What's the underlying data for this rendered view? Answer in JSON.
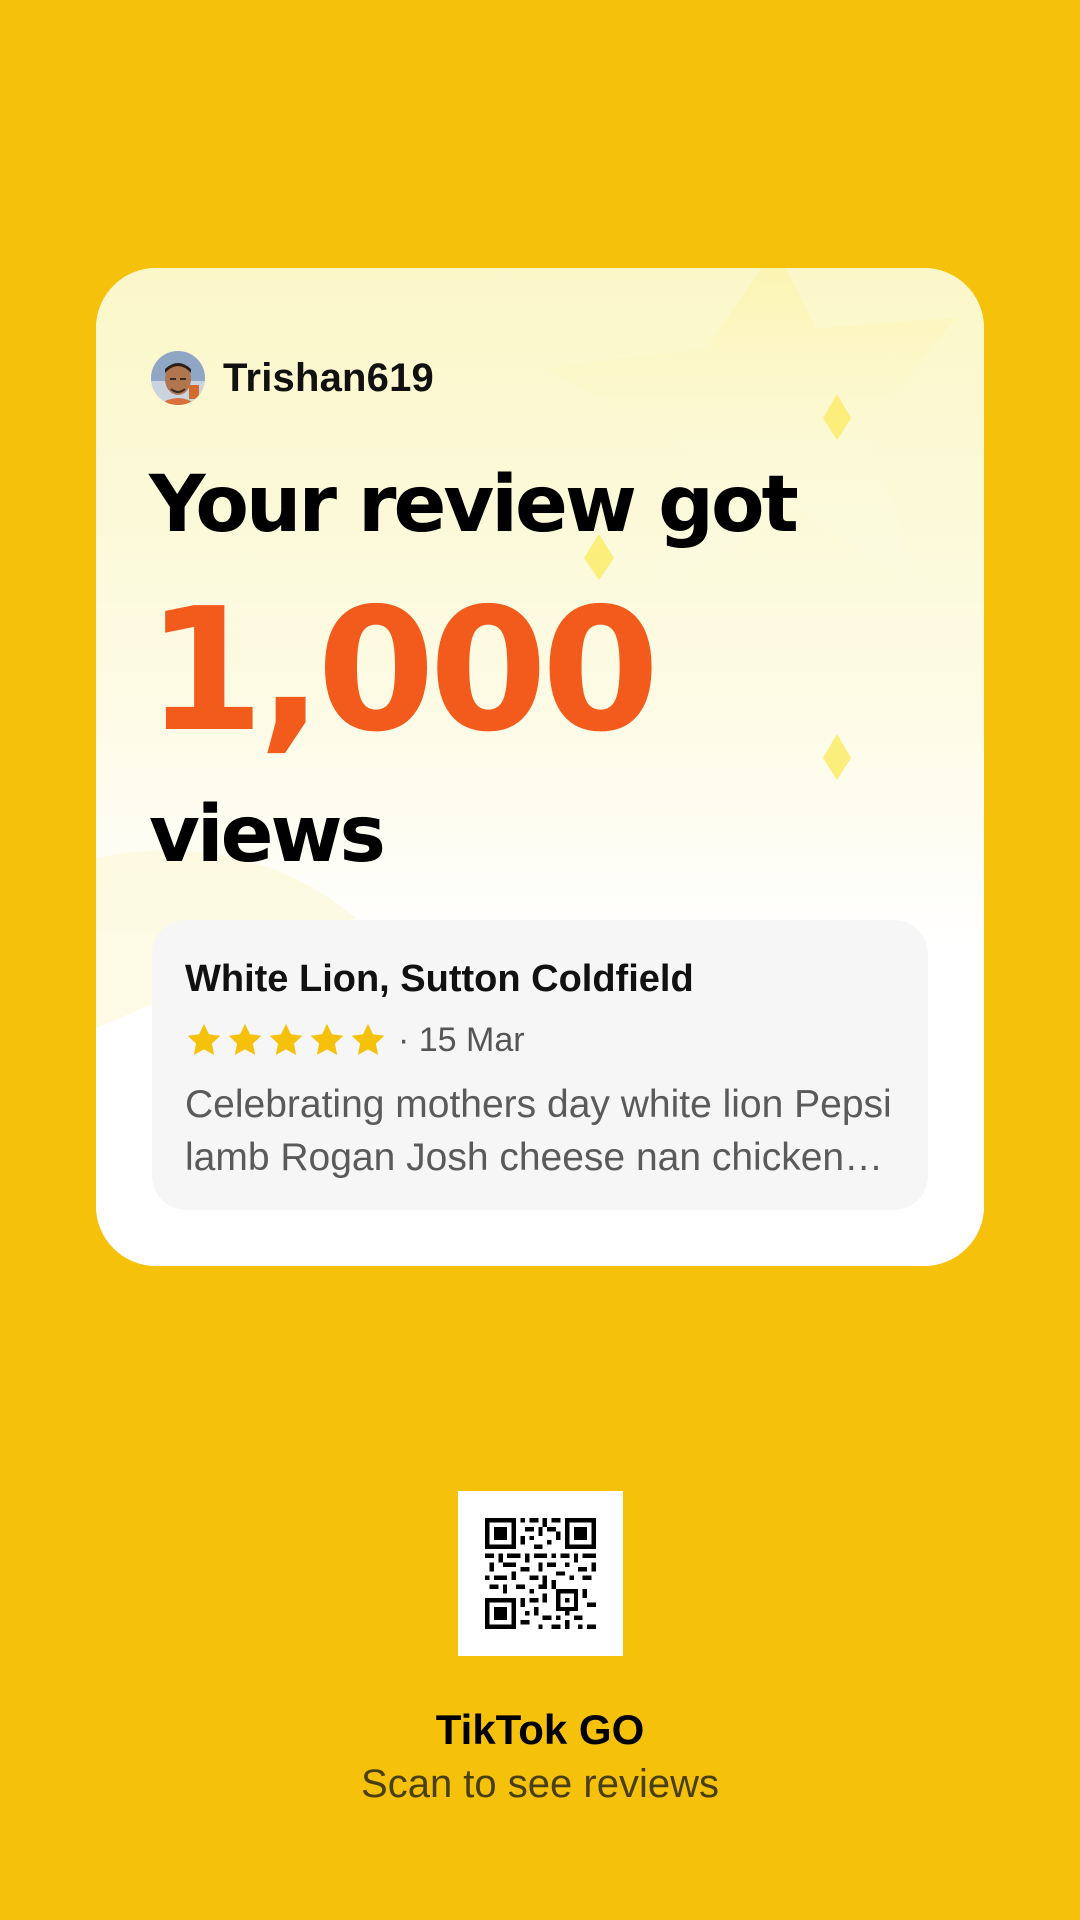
{
  "user": {
    "username": "Trishan619"
  },
  "headline": {
    "prefix": "Your review got",
    "count": "1,000",
    "suffix": "views"
  },
  "review": {
    "place": "White Lion, Sutton Coldfield",
    "rating": 5,
    "rating_max": 5,
    "date": "· 15 Mar",
    "text": "Celebrating mothers day white lion Pepsi lamb Rogan Josh cheese nan chicken tikka"
  },
  "footer": {
    "brand": "TikTok GO",
    "cta": "Scan to see reviews"
  },
  "colors": {
    "background": "#F5C10B",
    "accent_count": "#F35B1C",
    "star": "#F5C10B",
    "card": "#FFFFFF"
  },
  "icons": {
    "avatar": "user-avatar",
    "star": "star-icon",
    "qr": "qr-code"
  }
}
